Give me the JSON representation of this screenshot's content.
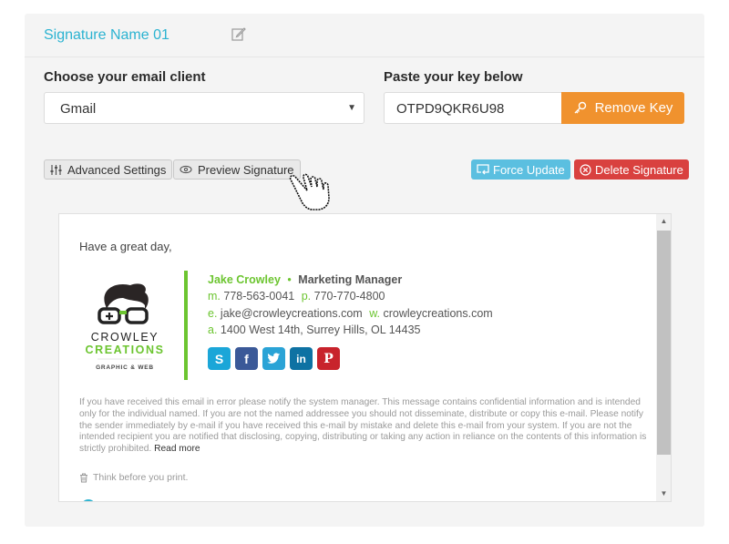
{
  "header": {
    "signature_name": "Signature Name 01"
  },
  "email_client": {
    "label": "Choose your email client",
    "selected": "Gmail"
  },
  "key": {
    "label": "Paste your key below",
    "value": "OTPD9QKR6U98",
    "remove_label": "Remove Key"
  },
  "actions": {
    "advanced_settings": "Advanced Settings",
    "preview_signature": "Preview Signature",
    "force_update": "Force Update",
    "delete_signature": "Delete Signature"
  },
  "colors": {
    "accent": "#2bb3d1",
    "orange": "#f0922e",
    "red": "#d9413f",
    "info": "#5bbfe0",
    "green": "#6cc530"
  },
  "preview": {
    "greeting": "Have a great day,",
    "logo": {
      "line1": "CROWLEY",
      "line2": "CREATIONS",
      "line3": "GRAPHIC & WEB"
    },
    "name": "Jake Crowley",
    "separator": "•",
    "job_title": "Marketing Manager",
    "mobile_prefix": "m.",
    "mobile": "778-563-0041",
    "phone_prefix": "p.",
    "phone": "770-770-4800",
    "email_prefix": "e.",
    "email": "jake@crowleycreations.com",
    "web_prefix": "w.",
    "web": "crowleycreations.com",
    "address_prefix": "a.",
    "address": "1400 West 14th, Surrey Hills, OL 14435",
    "socials": [
      {
        "name": "skype",
        "glyph": "S",
        "color": "#1ba6d8"
      },
      {
        "name": "facebook",
        "glyph": "f",
        "color": "#3b5998"
      },
      {
        "name": "twitter",
        "glyph": "t",
        "color": "#2aa3d6"
      },
      {
        "name": "linkedin",
        "glyph": "in",
        "color": "#0e72a3"
      },
      {
        "name": "pinterest",
        "glyph": "P",
        "color": "#c8232c"
      }
    ],
    "disclaimer": "If you have received this email in error please notify the system manager. This message contains confidential information and is intended only for the individual named. If you are not the named addressee you should not disseminate, distribute or copy this e-mail. Please notify the sender immediately by e-mail if you have received this e-mail by mistake and delete this e-mail from your system. If you are not the intended recipient you are notified that disclosing, copying, distributing or taking any action in reliance on the contents of this information is strictly prohibited.",
    "read_more": "Read more",
    "print_note": "Think before you print."
  },
  "scrollbar": {
    "up": "▲",
    "down": "▼"
  }
}
